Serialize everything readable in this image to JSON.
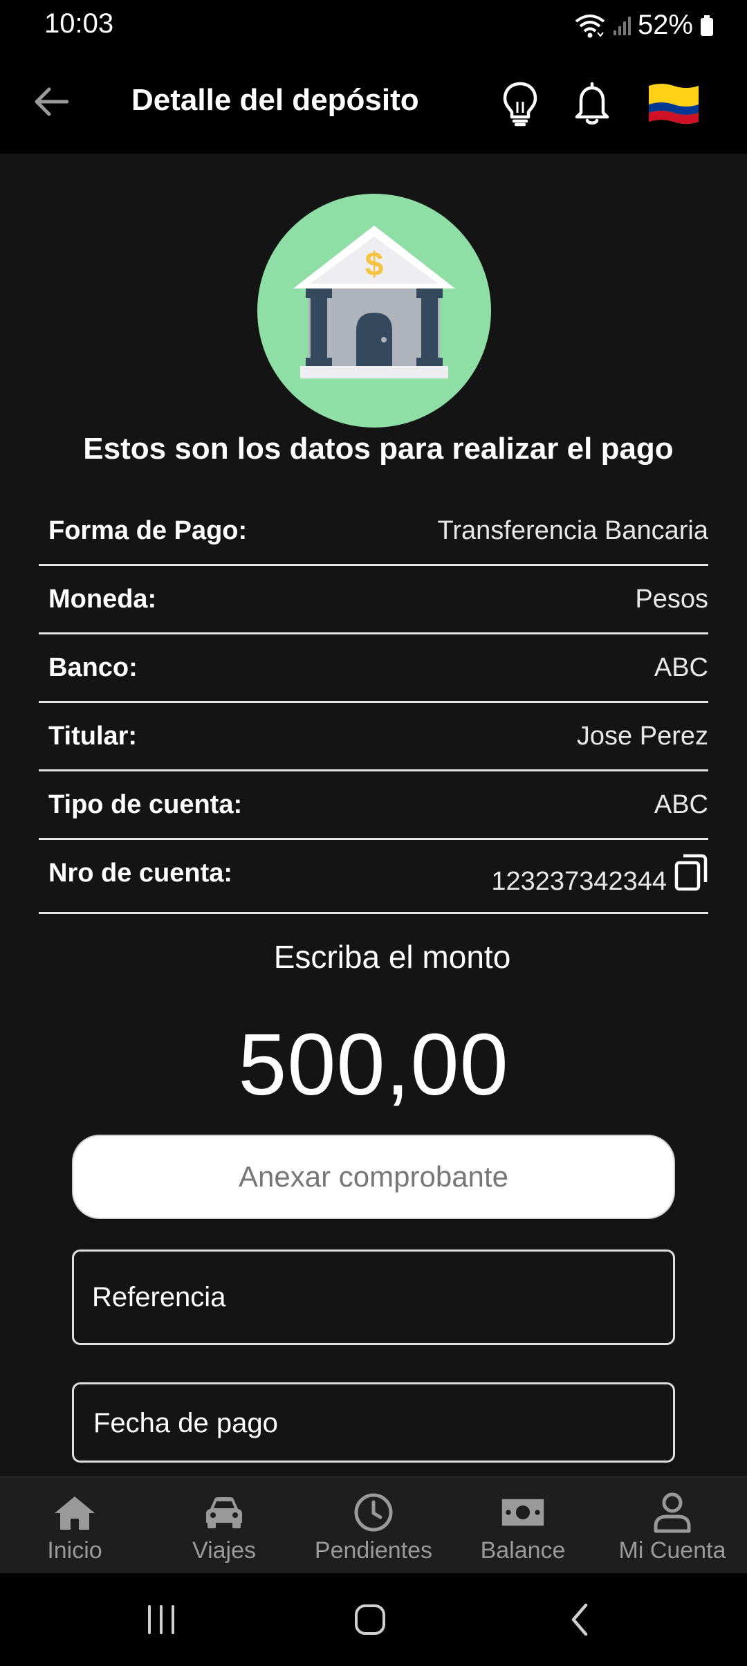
{
  "status": {
    "time": "10:03",
    "battery": "52%"
  },
  "header": {
    "title": "Detalle del depósito"
  },
  "hero": {
    "heading": "Estos son los datos para realizar el pago"
  },
  "details": [
    {
      "label": "Forma de Pago:",
      "value": "Transferencia Bancaria"
    },
    {
      "label": "Moneda:",
      "value": "Pesos"
    },
    {
      "label": "Banco:",
      "value": "ABC"
    },
    {
      "label": "Titular:",
      "value": "Jose Perez"
    },
    {
      "label": "Tipo de cuenta:",
      "value": "ABC"
    },
    {
      "label": "Nro de cuenta:",
      "value": "123237342344"
    }
  ],
  "amount": {
    "label": "Escriba el monto",
    "value": "500,00"
  },
  "form": {
    "attach_label": "Anexar comprobante",
    "reference_label": "Referencia",
    "date_label": "Fecha de pago"
  },
  "nav": {
    "items": [
      {
        "label": "Inicio",
        "icon": "home-icon"
      },
      {
        "label": "Viajes",
        "icon": "car-icon"
      },
      {
        "label": "Pendientes",
        "icon": "clock-icon"
      },
      {
        "label": "Balance",
        "icon": "cash-icon"
      },
      {
        "label": "Mi Cuenta",
        "icon": "user-icon"
      }
    ]
  },
  "colors": {
    "background": "#141414",
    "bank_circle": "#8fdea6",
    "nav_inactive": "#9a9a9a"
  }
}
